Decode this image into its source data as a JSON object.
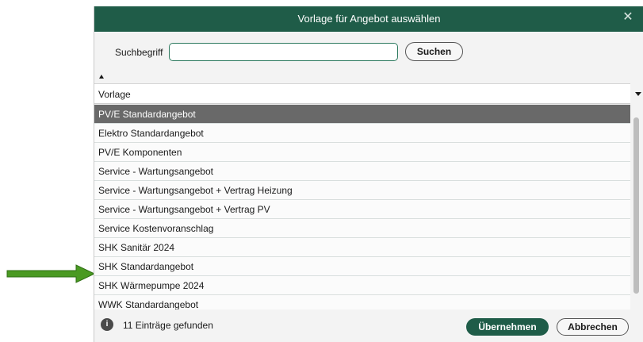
{
  "dialog": {
    "title": "Vorlage für Angebot auswählen",
    "close_icon": "close-icon"
  },
  "search": {
    "label": "Suchbegriff",
    "value": "",
    "placeholder": "",
    "button_label": "Suchen"
  },
  "table": {
    "column_header": "Vorlage",
    "sort_icon": "sort-ascending-icon",
    "column_menu_icon": "chevron-down-icon",
    "selected_index": 0,
    "rows": [
      "PV/E Standardangebot",
      "Elektro Standardangebot",
      "PV/E Komponenten",
      "Service - Wartungsangebot",
      "Service - Wartungsangebot + Vertrag Heizung",
      "Service - Wartungsangebot + Vertrag PV",
      "Service Kostenvoranschlag",
      "SHK Sanitär 2024",
      "SHK Standardangebot",
      "SHK Wärmepumpe 2024",
      "WWK Standardangebot"
    ]
  },
  "status": {
    "info_icon": "info-icon",
    "info_glyph": "i",
    "text": "11 Einträge gefunden"
  },
  "buttons": {
    "apply": "Übernehmen",
    "cancel": "Abbrechen"
  },
  "annotation": {
    "arrow_icon": "arrow-right-icon",
    "arrow_color": "#4a9a22",
    "points_to_row": "SHK Standardangebot"
  },
  "colors": {
    "accent": "#1f5c48",
    "selection": "#696969",
    "background": "#f3f3f3"
  }
}
